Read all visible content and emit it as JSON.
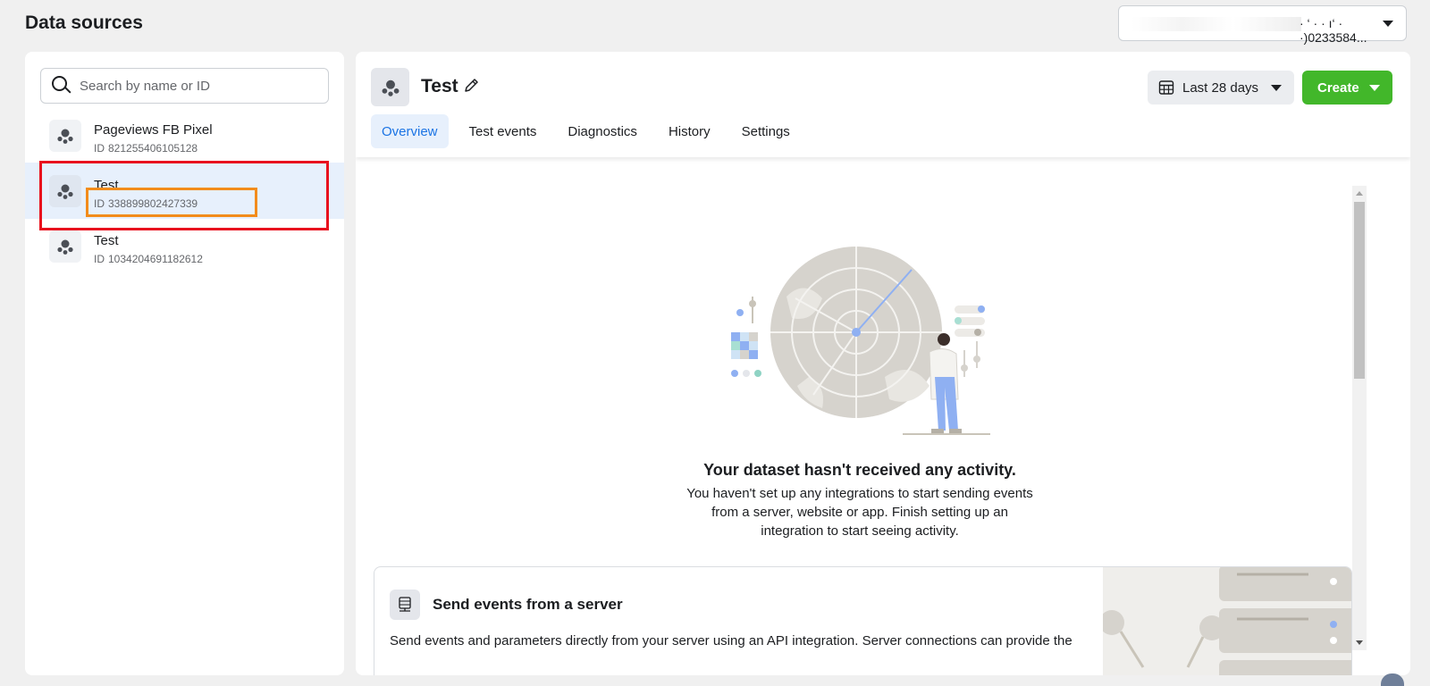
{
  "page": {
    "title": "Data sources"
  },
  "account_selector": {
    "value": "·   ‘ · · ı‘ · ·)0233584..."
  },
  "sidebar": {
    "search_placeholder": "Search by name or ID",
    "items": [
      {
        "name": "Pageviews FB Pixel",
        "id_prefix": "ID",
        "id": "821255406105128",
        "selected": false
      },
      {
        "name": "Test",
        "id_prefix": "ID",
        "id": "338899802427339",
        "selected": true
      },
      {
        "name": "Test",
        "id_prefix": "ID",
        "id": "1034204691182612",
        "selected": false
      }
    ]
  },
  "main": {
    "dataset_name": "Test",
    "date_range": "Last 28 days",
    "create_label": "Create",
    "tabs": [
      {
        "label": "Overview",
        "active": true
      },
      {
        "label": "Test events",
        "active": false
      },
      {
        "label": "Diagnostics",
        "active": false
      },
      {
        "label": "History",
        "active": false
      },
      {
        "label": "Settings",
        "active": false
      }
    ],
    "empty_state": {
      "title": "Your dataset hasn't received any activity.",
      "body": "You haven't set up any integrations to start sending events from a server, website or app. Finish setting up an integration to start seeing activity."
    },
    "server_card": {
      "title": "Send events from a server",
      "description": "Send events and parameters directly from your server using an API integration. Server connections can provide the"
    }
  },
  "colors": {
    "accent_blue": "#1b74e4",
    "create_green": "#42b72a",
    "highlight_red": "#e8121e",
    "highlight_orange": "#f28c1b",
    "selected_bg": "#e7f0fc"
  },
  "icons": [
    "search-icon",
    "dataset-icon",
    "edit-pencil-icon",
    "calendar-icon",
    "chevron-down-icon",
    "server-icon",
    "radar-illustration"
  ]
}
